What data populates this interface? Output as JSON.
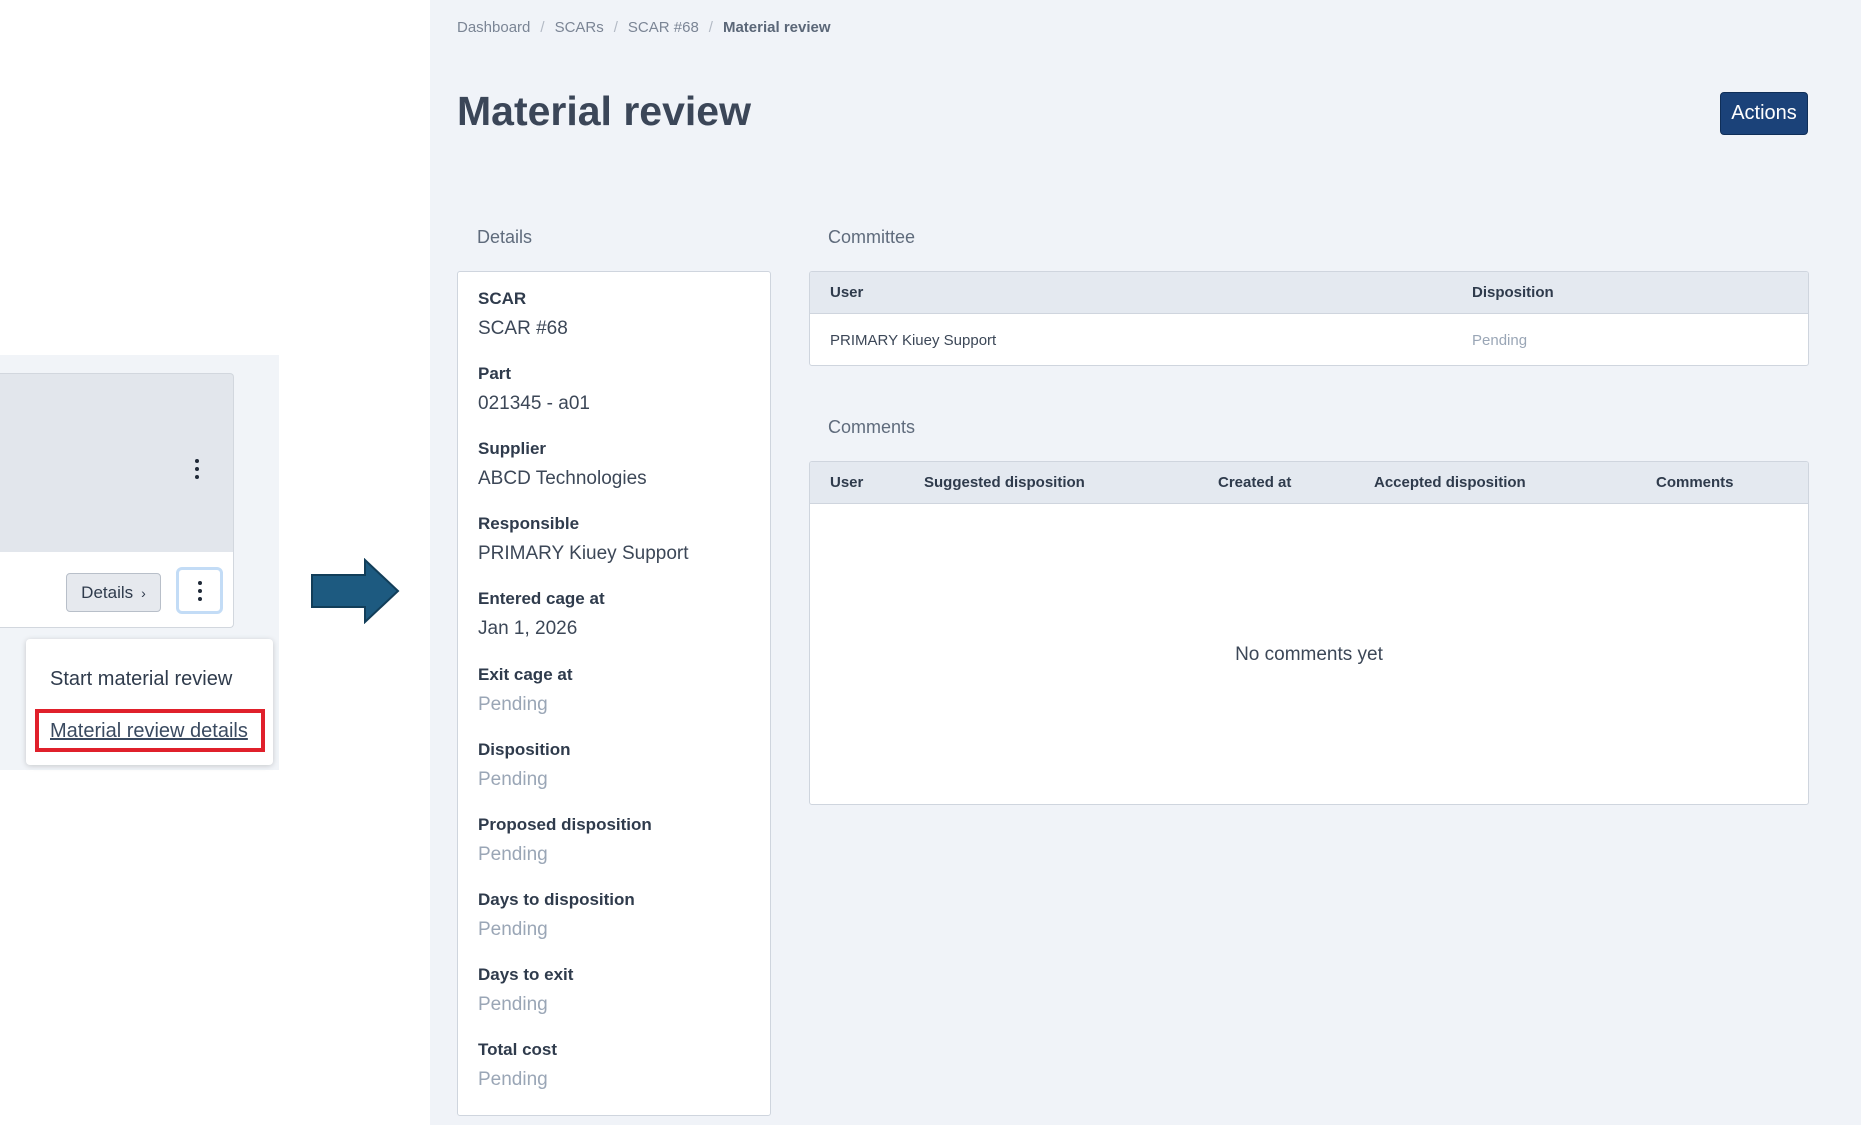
{
  "inset": {
    "details_button": "Details",
    "menu": {
      "items": [
        "Start material review",
        "Material review details"
      ]
    }
  },
  "breadcrumb": [
    "Dashboard",
    "SCARs",
    "SCAR #68",
    "Material review"
  ],
  "page_title": "Material review",
  "actions_label": "Actions",
  "details": {
    "label": "Details",
    "fields": [
      {
        "label": "SCAR",
        "value": "SCAR #68"
      },
      {
        "label": "Part",
        "value": "021345 - a01"
      },
      {
        "label": "Supplier",
        "value": "ABCD Technologies"
      },
      {
        "label": "Responsible",
        "value": "PRIMARY Kiuey Support"
      },
      {
        "label": "Entered cage at",
        "value": "Jan 1, 2026"
      },
      {
        "label": "Exit cage at",
        "value": "Pending"
      },
      {
        "label": "Disposition",
        "value": "Pending"
      },
      {
        "label": "Proposed disposition",
        "value": "Pending"
      },
      {
        "label": "Days to disposition",
        "value": "Pending"
      },
      {
        "label": "Days to exit",
        "value": "Pending"
      },
      {
        "label": "Total cost",
        "value": "Pending"
      }
    ]
  },
  "committee": {
    "label": "Committee",
    "columns": [
      "User",
      "Disposition"
    ],
    "rows": [
      {
        "user": "PRIMARY Kiuey Support",
        "disposition": "Pending"
      }
    ]
  },
  "comments": {
    "label": "Comments",
    "columns": [
      "User",
      "Suggested disposition",
      "Created at",
      "Accepted disposition",
      "Comments"
    ],
    "empty_text": "No comments yet"
  },
  "colors": {
    "primary_button": "#1b4279",
    "highlight": "#e0202b",
    "arrow": "#1d5a80",
    "pending_text": "#9aa6b6"
  },
  "icons": [
    "kebab-icon",
    "chevron-right-icon",
    "arrow-right-icon"
  ]
}
